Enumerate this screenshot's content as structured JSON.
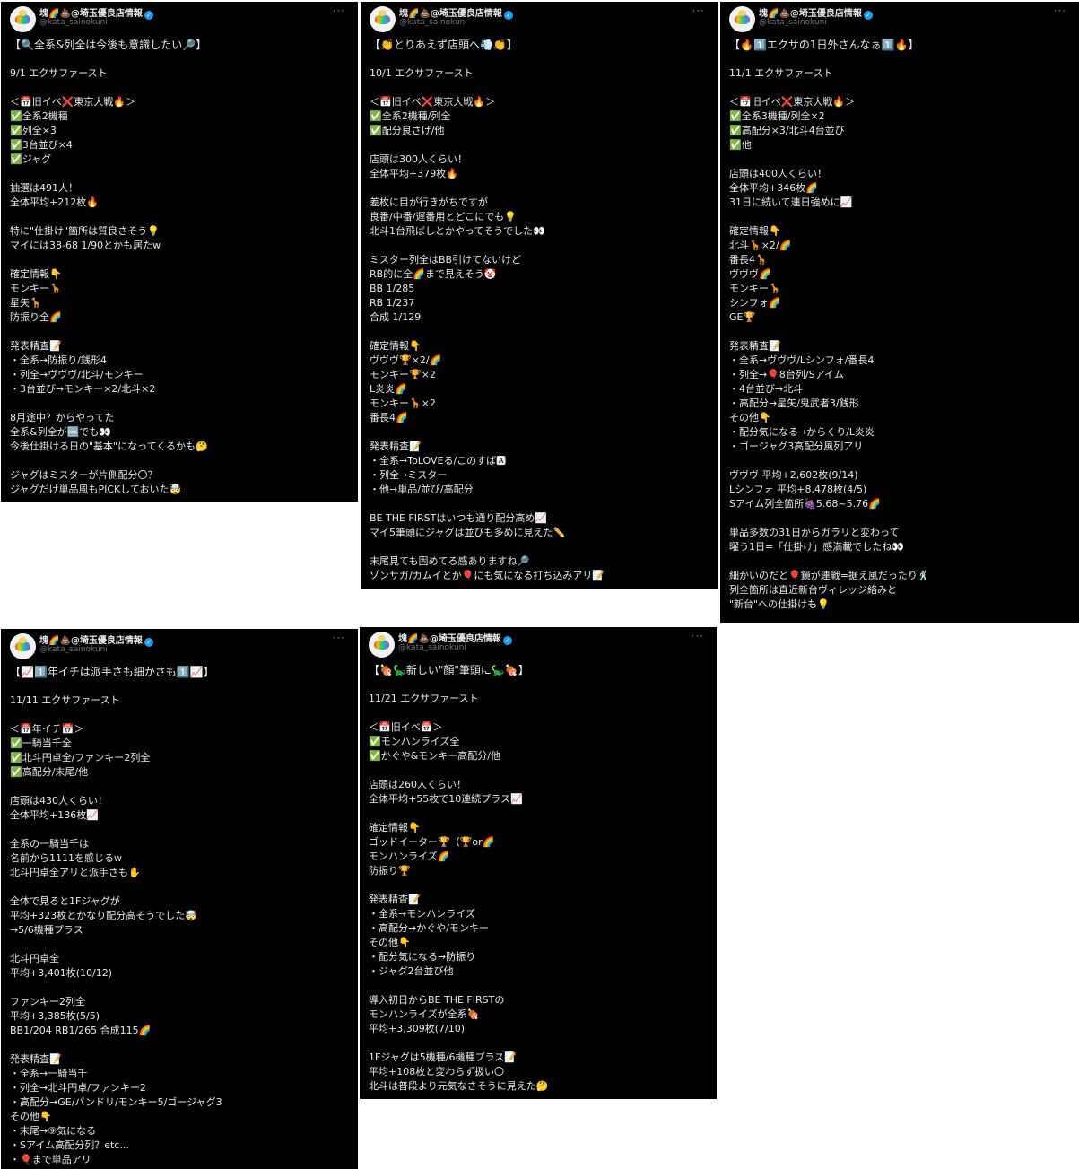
{
  "account": {
    "name": "塊🌈💩@埼玉優良店情報",
    "handle": "@kata_sainokuni",
    "more": "···"
  },
  "tweets": [
    {
      "lines": [
        "【🔍全系&列全は今後も意識したい🔎】",
        "",
        "9/1 エクサファースト",
        "",
        "＜📅旧イベ❌東京大戦🔥＞",
        "✅全系2機種",
        "✅列全×3",
        "✅3台並び×4",
        "✅ジャグ",
        "",
        "抽選は491人！",
        "全体平均+212枚🔥",
        "",
        "特に\"仕掛け\"箇所は質良さそう💡",
        "マイには38-68 1/90とかも居たw",
        "",
        "確定情報👇",
        "モンキー🦒",
        "星矢🦒",
        "防振り全🌈",
        "",
        "発表精査📝",
        "・全系→防振り/銭形4",
        "・列全→ヴヴヴ/北斗/モンキー",
        "・3台並び→モンキー×2/北斗×2",
        "",
        "8月途中？からやってた",
        "全系&列全が🆒でも👀",
        "今後仕掛ける日の\"基本\"になってくるかも🤔",
        "",
        "ジャグはミスターが片側配分〇？",
        "ジャグだけ単品風もPICKしておいた🤯"
      ]
    },
    {
      "lines": [
        "【👏とりあえず店頭へ💨👏】",
        "",
        "10/1 エクサファースト",
        "",
        "＜📅旧イベ❌東京大戦🔥＞",
        "✅全系2機種/列全",
        "✅配分良さげ/他",
        "",
        "店頭は300人くらい！",
        "全体平均+379枚🔥",
        "",
        "差枚に目が行きがちですが",
        "良番/中番/遅番用とどこにでも💡",
        "北斗1台飛ばしとかやってそうでした👀",
        "",
        "ミスター列全はBB引けてないけど",
        "RB的に全🌈まで見えそう🤡",
        "BB 1/285",
        "RB 1/237",
        "合成 1/129",
        "",
        "確定情報👇",
        "ヴヴヴ🏆×2/🌈",
        "モンキー🏆×2",
        "L炎炎🌈",
        "モンキー🦒×2",
        "番長4🌈",
        "",
        "発表精査📝",
        "・全系→ToLOVEる/このすば🅰",
        "・列全→ミスター",
        "・他→単品/並び/高配分",
        "",
        "BE THE FIRSTはいつも通り配分高め📈",
        "マイ5筆頭にジャグは並びも多めに見えた✏️",
        "",
        "末尾見ても固めてる感ありますね🔎",
        "ゾンサガ/カムイとか🎈にも気になる打ち込みアリ📝"
      ]
    },
    {
      "lines": [
        "【🔥1️⃣エクサの1日外さんなぁ1️⃣🔥】",
        "",
        "11/1 エクサファースト",
        "",
        "＜📅旧イベ❌東京大戦🔥＞",
        "✅全系3機種/列全×2",
        "✅高配分×3/北斗4台並び",
        "✅他",
        "",
        "店頭は400人くらい！",
        "全体平均+346枚🌈",
        "31日に続いて連日強めに📈",
        "",
        "確定情報👇",
        "北斗🦒×2/🌈",
        "番長4🦒",
        "ヴヴヴ🌈",
        "モンキー🦒",
        "シンフォ🌈",
        "GE🏆",
        "",
        "発表精査📝",
        "・全系→ヴヴヴ/Lシンフォ/番長4",
        "・列全→🎈8台列/Sアイム",
        "・4台並び→北斗",
        "・高配分→星矢/鬼武者3/銭形",
        "その他👇",
        "・配分気になる→からくり/L炎炎",
        "・ゴージャグ3高配分風列アリ",
        "",
        "ヴヴヴ 平均+2,602枚(9/14)",
        "Lシンフォ 平均+8,478枚(4/5)",
        "Sアイム列全箇所🍇5.68~5.76🌈",
        "",
        "単品多数の31日からガラリと変わって",
        "曜う1日=「仕掛け」感満載でしたね👀",
        "",
        "細かいのだと🎈鏡が連戦=据え風だったり🕺",
        "列全箇所は直近新台ヴィレッジ絡みと",
        "\"新台\"への仕掛けも💡"
      ]
    },
    {
      "lines": [
        "【📈1️⃣年イチは派手さも細かさも1️⃣📈】",
        "",
        "11/11 エクサファースト",
        "",
        "＜📅年イチ📅＞",
        "✅一騎当千全",
        "✅北斗円卓全/ファンキー2列全",
        "✅高配分/末尾/他",
        "",
        "店頭は430人くらい！",
        "全体平均+136枚📈",
        "",
        "全系の一騎当千は",
        "名前から1111を感じるw",
        "北斗円卓全アリと派手さも✋",
        "",
        "全体で見ると1Fジャグが",
        "平均+323枚とかなり配分高そうでした🤯",
        "→5/6機種プラス",
        "",
        "北斗円卓全",
        "平均+3,401枚(10/12)",
        "",
        "ファンキー2列全",
        "平均+3,385枚(5/5)",
        "BB1/204 RB1/265 合成115🌈",
        "",
        "発表精査📝",
        "・全系→一騎当千",
        "・列全→北斗円卓/ファンキー2",
        "・高配分→GE/バンドリ/モンキー5/ゴージャグ3",
        "その他👇",
        "・末尾→⑨気になる",
        "・Sアイム高配分列？etc...",
        "・🎈まで単品アリ"
      ]
    },
    {
      "lines": [
        "【🍖🦕新しい\"顔\"筆頭に🦕🍖】",
        "",
        "11/21 エクサファースト",
        "",
        "＜📅旧イベ📅＞",
        "✅モンハンライズ全",
        "✅かぐや&モンキー高配分/他",
        "",
        "店頭は260人くらい！",
        "全体平均+55枚で10連続プラス📈",
        "",
        "確定情報👇",
        "ゴッドイーター🏆（🏆or🌈",
        "モンハンライズ🌈",
        "防振り🏆",
        "",
        "発表精査📝",
        "・全系→モンハンライズ",
        "・高配分→かぐや/モンキー",
        "その他👇",
        "・配分気になる→防振り",
        "・ジャグ2台並び他",
        "",
        "導入初日からBE THE FIRSTの",
        "モンハンライズが全系🍖",
        "平均+3,309枚(7/10)",
        "",
        "1Fジャグは5機種/6機種プラス📝",
        "平均+108枚と変わらず扱い〇",
        "北斗は普段より元気なさそうに見えた🤔"
      ]
    }
  ]
}
